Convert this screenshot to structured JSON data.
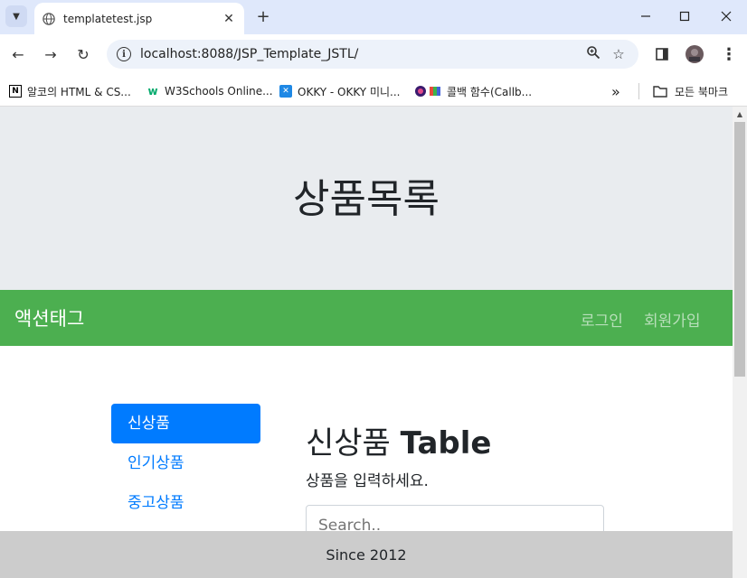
{
  "browser": {
    "tab_title": "templatetest.jsp",
    "url": "localhost:8088/JSP_Template_JSTL/",
    "bookmarks": [
      {
        "label": "알코의 HTML & CS...",
        "icon": "notion-icon"
      },
      {
        "label": "W3Schools Online...",
        "icon": "w3schools-icon"
      },
      {
        "label": "OKKY - OKKY 미니...",
        "icon": "okky-icon"
      },
      {
        "label": "콜백 함수(Callb...",
        "icon": "colorful-icon"
      }
    ],
    "all_bookmarks_label": "모든 북마크",
    "overflow_label": "»"
  },
  "page": {
    "jumbotron_title": "상품목록",
    "navbar": {
      "brand": "액션태그",
      "links": [
        "로그인",
        "회원가입"
      ]
    },
    "sidebar": [
      "신상품",
      "인기상품",
      "중고상품"
    ],
    "content": {
      "heading_main": "신상품",
      "heading_bold": "Table",
      "description": "상품을 입력하세요.",
      "search_placeholder": "Search.."
    },
    "footer": "Since 2012"
  },
  "colors": {
    "navbar_bg": "#4caf50",
    "jumbotron_bg": "#e9ecef",
    "accent": "#007bff",
    "footer_bg": "#cccccc"
  }
}
